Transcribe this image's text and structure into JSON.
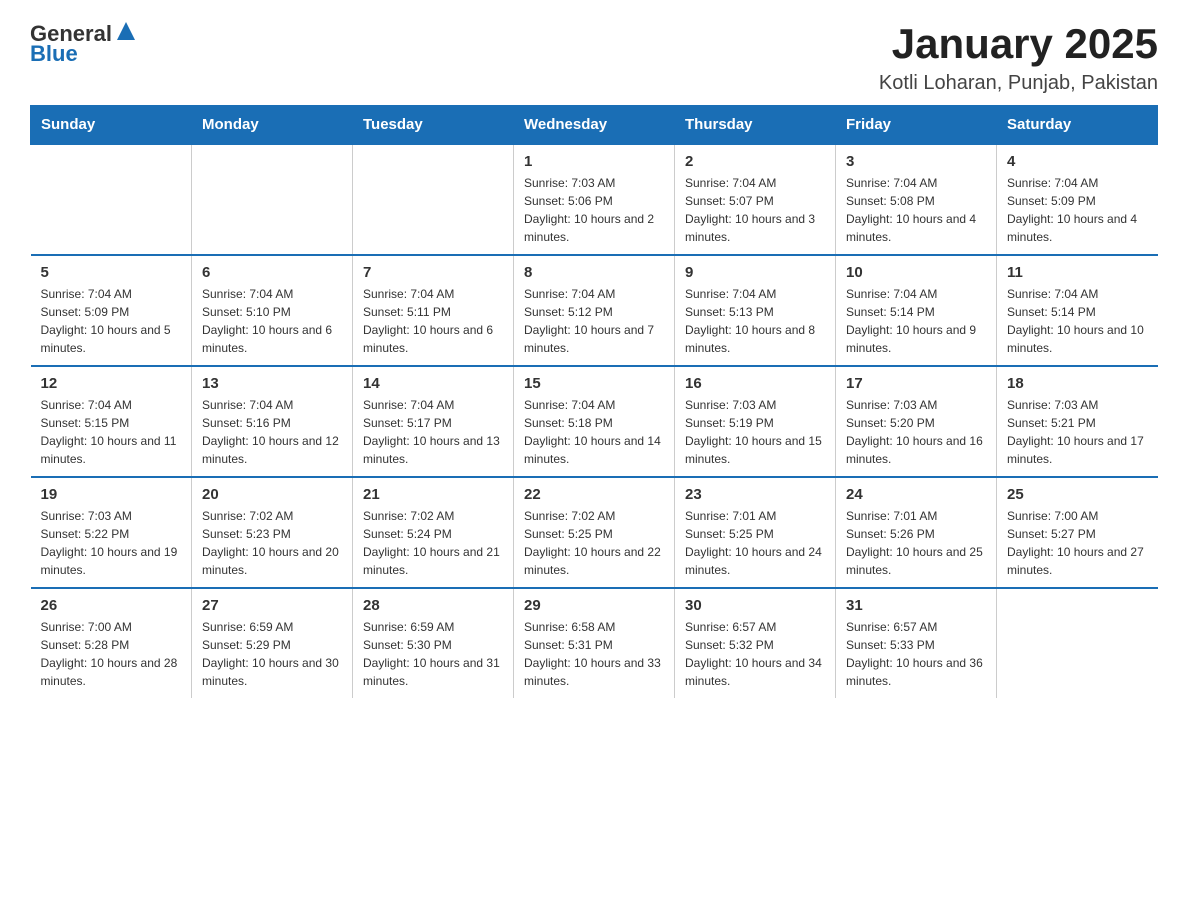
{
  "logo": {
    "text_general": "General",
    "text_blue": "Blue",
    "triangle_aria": "logo triangle"
  },
  "header": {
    "title": "January 2025",
    "subtitle": "Kotli Loharan, Punjab, Pakistan"
  },
  "calendar": {
    "days_of_week": [
      "Sunday",
      "Monday",
      "Tuesday",
      "Wednesday",
      "Thursday",
      "Friday",
      "Saturday"
    ],
    "weeks": [
      [
        {
          "day": "",
          "info": ""
        },
        {
          "day": "",
          "info": ""
        },
        {
          "day": "",
          "info": ""
        },
        {
          "day": "1",
          "info": "Sunrise: 7:03 AM\nSunset: 5:06 PM\nDaylight: 10 hours and 2 minutes."
        },
        {
          "day": "2",
          "info": "Sunrise: 7:04 AM\nSunset: 5:07 PM\nDaylight: 10 hours and 3 minutes."
        },
        {
          "day": "3",
          "info": "Sunrise: 7:04 AM\nSunset: 5:08 PM\nDaylight: 10 hours and 4 minutes."
        },
        {
          "day": "4",
          "info": "Sunrise: 7:04 AM\nSunset: 5:09 PM\nDaylight: 10 hours and 4 minutes."
        }
      ],
      [
        {
          "day": "5",
          "info": "Sunrise: 7:04 AM\nSunset: 5:09 PM\nDaylight: 10 hours and 5 minutes."
        },
        {
          "day": "6",
          "info": "Sunrise: 7:04 AM\nSunset: 5:10 PM\nDaylight: 10 hours and 6 minutes."
        },
        {
          "day": "7",
          "info": "Sunrise: 7:04 AM\nSunset: 5:11 PM\nDaylight: 10 hours and 6 minutes."
        },
        {
          "day": "8",
          "info": "Sunrise: 7:04 AM\nSunset: 5:12 PM\nDaylight: 10 hours and 7 minutes."
        },
        {
          "day": "9",
          "info": "Sunrise: 7:04 AM\nSunset: 5:13 PM\nDaylight: 10 hours and 8 minutes."
        },
        {
          "day": "10",
          "info": "Sunrise: 7:04 AM\nSunset: 5:14 PM\nDaylight: 10 hours and 9 minutes."
        },
        {
          "day": "11",
          "info": "Sunrise: 7:04 AM\nSunset: 5:14 PM\nDaylight: 10 hours and 10 minutes."
        }
      ],
      [
        {
          "day": "12",
          "info": "Sunrise: 7:04 AM\nSunset: 5:15 PM\nDaylight: 10 hours and 11 minutes."
        },
        {
          "day": "13",
          "info": "Sunrise: 7:04 AM\nSunset: 5:16 PM\nDaylight: 10 hours and 12 minutes."
        },
        {
          "day": "14",
          "info": "Sunrise: 7:04 AM\nSunset: 5:17 PM\nDaylight: 10 hours and 13 minutes."
        },
        {
          "day": "15",
          "info": "Sunrise: 7:04 AM\nSunset: 5:18 PM\nDaylight: 10 hours and 14 minutes."
        },
        {
          "day": "16",
          "info": "Sunrise: 7:03 AM\nSunset: 5:19 PM\nDaylight: 10 hours and 15 minutes."
        },
        {
          "day": "17",
          "info": "Sunrise: 7:03 AM\nSunset: 5:20 PM\nDaylight: 10 hours and 16 minutes."
        },
        {
          "day": "18",
          "info": "Sunrise: 7:03 AM\nSunset: 5:21 PM\nDaylight: 10 hours and 17 minutes."
        }
      ],
      [
        {
          "day": "19",
          "info": "Sunrise: 7:03 AM\nSunset: 5:22 PM\nDaylight: 10 hours and 19 minutes."
        },
        {
          "day": "20",
          "info": "Sunrise: 7:02 AM\nSunset: 5:23 PM\nDaylight: 10 hours and 20 minutes."
        },
        {
          "day": "21",
          "info": "Sunrise: 7:02 AM\nSunset: 5:24 PM\nDaylight: 10 hours and 21 minutes."
        },
        {
          "day": "22",
          "info": "Sunrise: 7:02 AM\nSunset: 5:25 PM\nDaylight: 10 hours and 22 minutes."
        },
        {
          "day": "23",
          "info": "Sunrise: 7:01 AM\nSunset: 5:25 PM\nDaylight: 10 hours and 24 minutes."
        },
        {
          "day": "24",
          "info": "Sunrise: 7:01 AM\nSunset: 5:26 PM\nDaylight: 10 hours and 25 minutes."
        },
        {
          "day": "25",
          "info": "Sunrise: 7:00 AM\nSunset: 5:27 PM\nDaylight: 10 hours and 27 minutes."
        }
      ],
      [
        {
          "day": "26",
          "info": "Sunrise: 7:00 AM\nSunset: 5:28 PM\nDaylight: 10 hours and 28 minutes."
        },
        {
          "day": "27",
          "info": "Sunrise: 6:59 AM\nSunset: 5:29 PM\nDaylight: 10 hours and 30 minutes."
        },
        {
          "day": "28",
          "info": "Sunrise: 6:59 AM\nSunset: 5:30 PM\nDaylight: 10 hours and 31 minutes."
        },
        {
          "day": "29",
          "info": "Sunrise: 6:58 AM\nSunset: 5:31 PM\nDaylight: 10 hours and 33 minutes."
        },
        {
          "day": "30",
          "info": "Sunrise: 6:57 AM\nSunset: 5:32 PM\nDaylight: 10 hours and 34 minutes."
        },
        {
          "day": "31",
          "info": "Sunrise: 6:57 AM\nSunset: 5:33 PM\nDaylight: 10 hours and 36 minutes."
        },
        {
          "day": "",
          "info": ""
        }
      ]
    ]
  }
}
